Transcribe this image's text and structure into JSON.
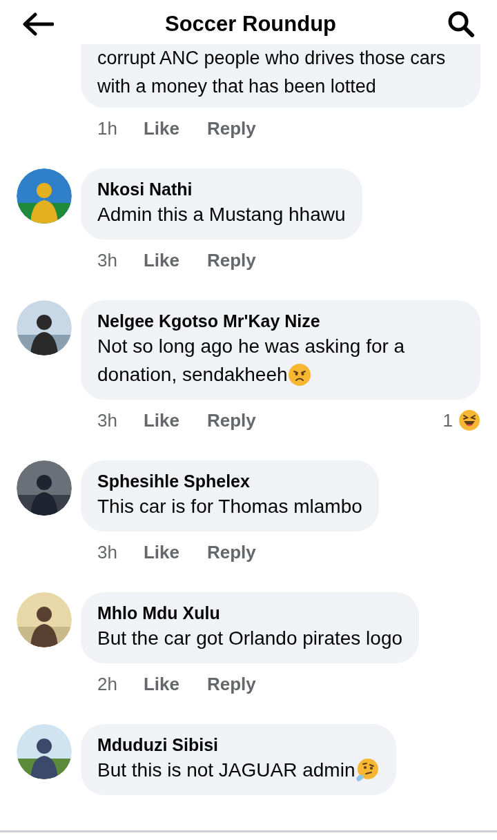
{
  "header": {
    "title": "Soccer Roundup"
  },
  "comments": [
    {
      "kind": "plain",
      "text": "corrupt ANC people who drives those cars with a money that has been lotted",
      "time": "1h",
      "like": "Like",
      "reply": "Reply",
      "cut": true
    },
    {
      "kind": "plain",
      "author": "Nkosi Nathi",
      "text": "Admin  this a Mustang hhawu",
      "time": "3h",
      "like": "Like",
      "reply": "Reply"
    },
    {
      "kind": "angry",
      "author": "Nelgee Kgotso Mr'Kay Nize",
      "text": "Not so long ago he was asking for a donation, sendakheeh",
      "time": "3h",
      "like": "Like",
      "reply": "Reply",
      "reactions": {
        "count": "1",
        "kind": "laugh"
      }
    },
    {
      "kind": "plain",
      "author": "Sphesihle Sphelex",
      "text": "This car is for Thomas mlambo",
      "time": "3h",
      "like": "Like",
      "reply": "Reply"
    },
    {
      "kind": "plain",
      "author": "Mhlo Mdu Xulu",
      "text": "But the car got Orlando pirates logo",
      "time": "2h",
      "like": "Like",
      "reply": "Reply"
    },
    {
      "kind": "thinking",
      "author": "Mduduzi Sibisi",
      "text": "But this is not JAGUAR admin"
    }
  ]
}
